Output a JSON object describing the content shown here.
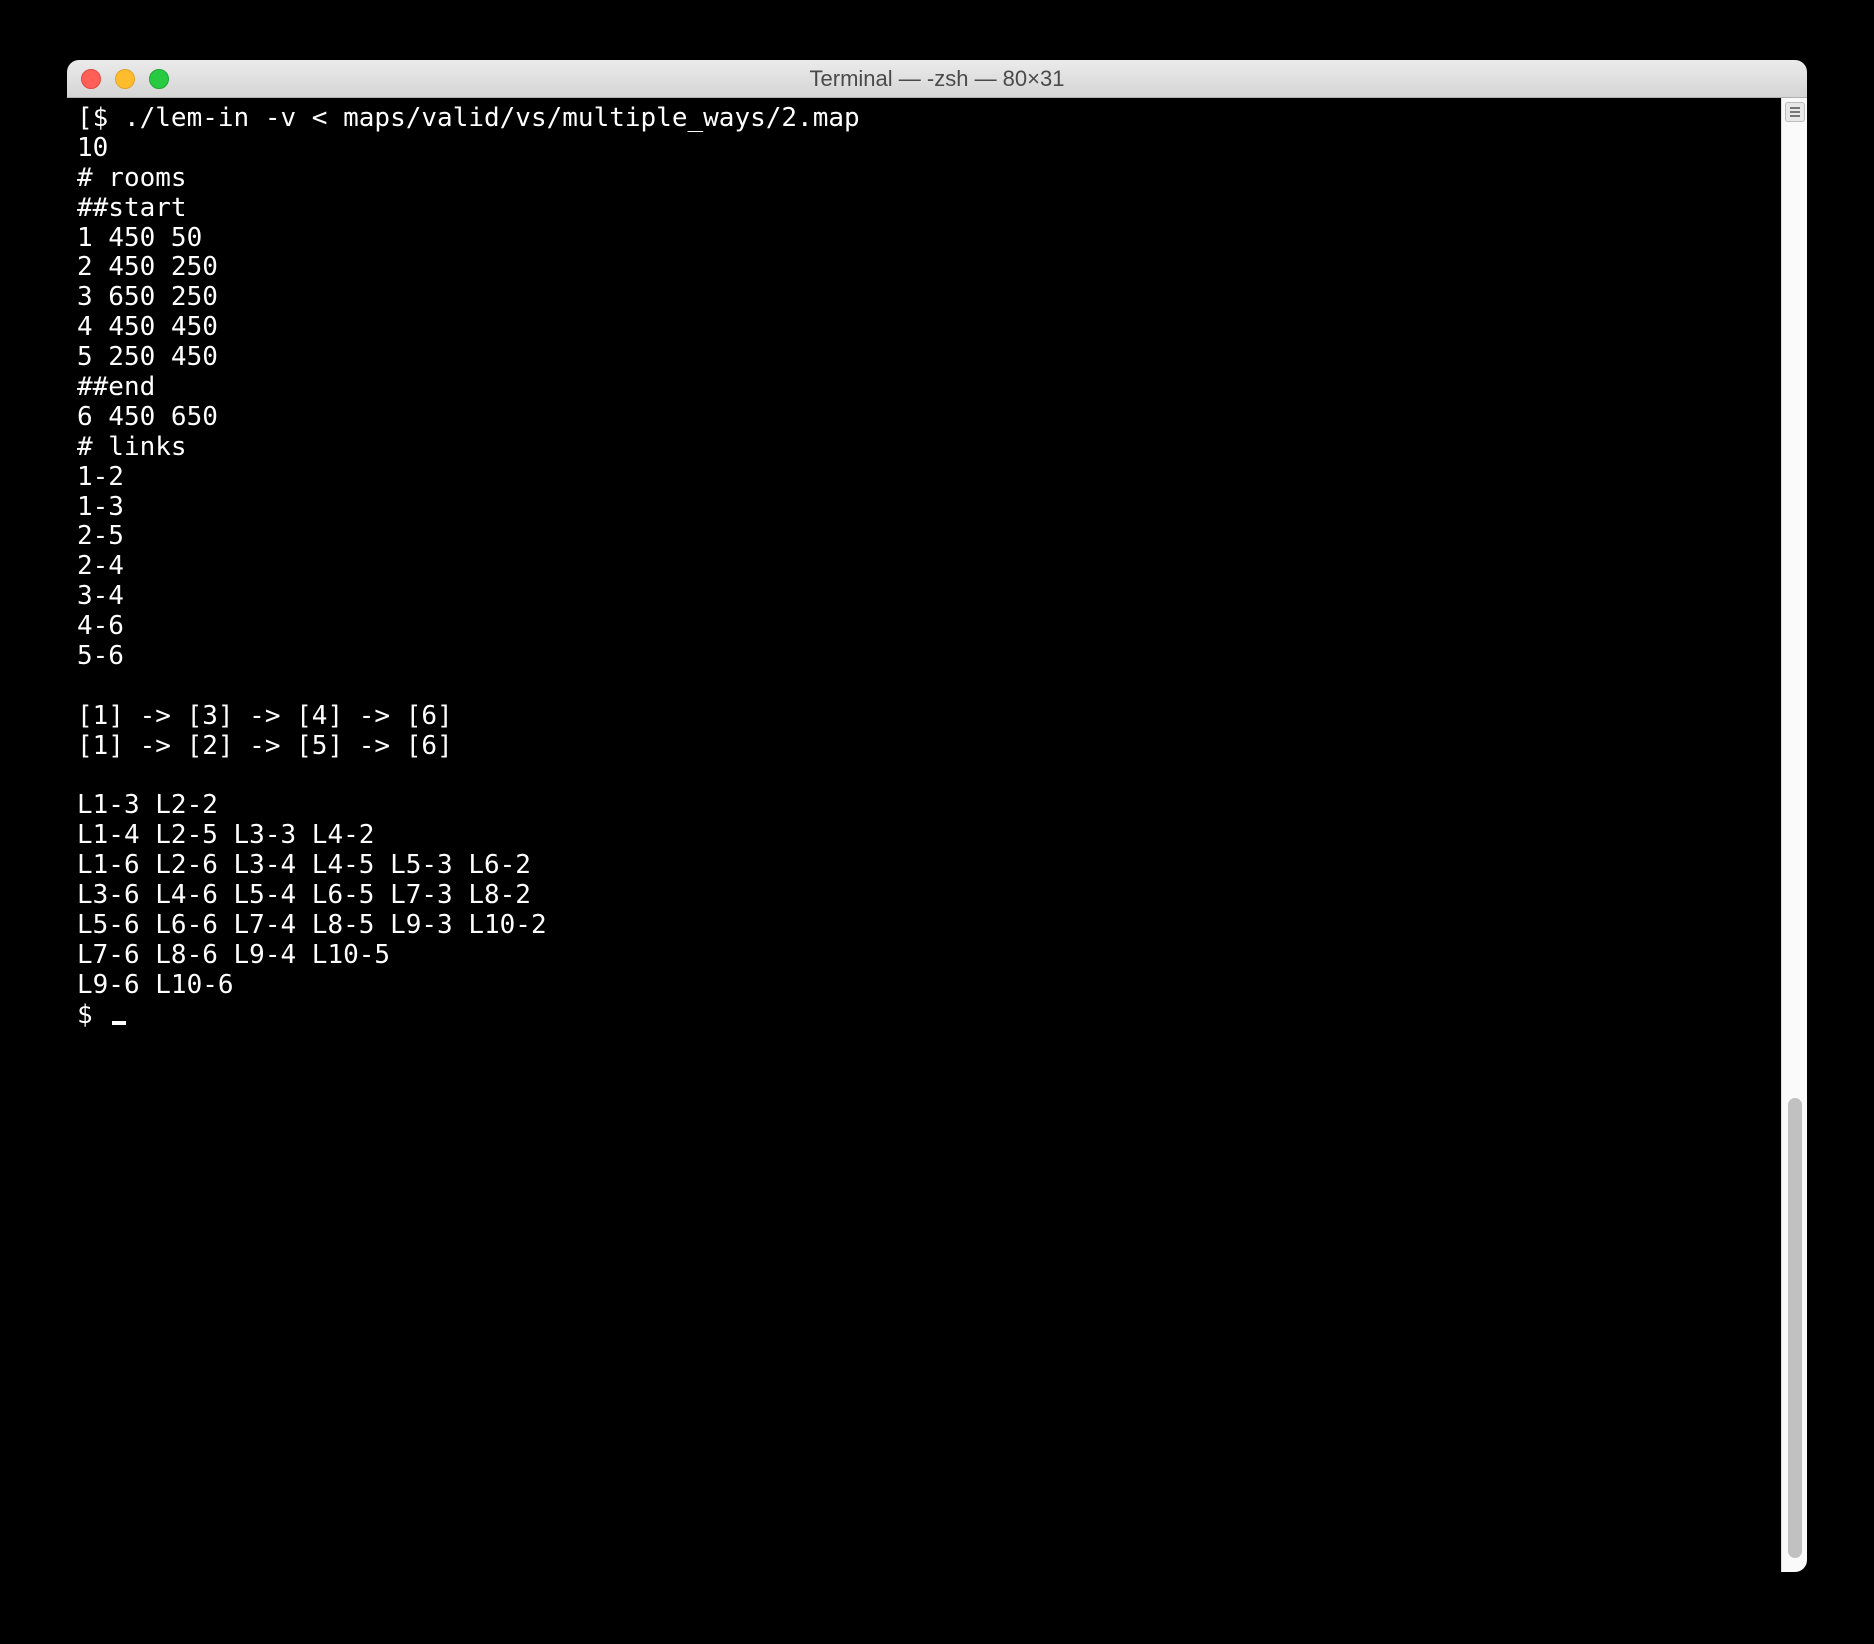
{
  "window": {
    "title": "Terminal — -zsh — 80×31"
  },
  "terminal": {
    "prompt": "$",
    "command": "./lem-in -v < maps/valid/vs/multiple_ways/2.map",
    "lines": [
      "10",
      "# rooms",
      "##start",
      "1 450 50",
      "2 450 250",
      "3 650 250",
      "4 450 450",
      "5 250 450",
      "##end",
      "6 450 650",
      "# links",
      "1-2",
      "1-3",
      "2-5",
      "2-4",
      "3-4",
      "4-6",
      "5-6",
      "",
      "[1] -> [3] -> [4] -> [6]",
      "[1] -> [2] -> [5] -> [6]",
      "",
      "L1-3 L2-2",
      "L1-4 L2-5 L3-3 L4-2",
      "L1-6 L2-6 L3-4 L4-5 L5-3 L6-2",
      "L3-6 L4-6 L5-4 L6-5 L7-3 L8-2",
      "L5-6 L6-6 L7-4 L8-5 L9-3 L10-2",
      "L7-6 L8-6 L9-4 L10-5",
      "L9-6 L10-6"
    ],
    "prompt2": "$"
  }
}
